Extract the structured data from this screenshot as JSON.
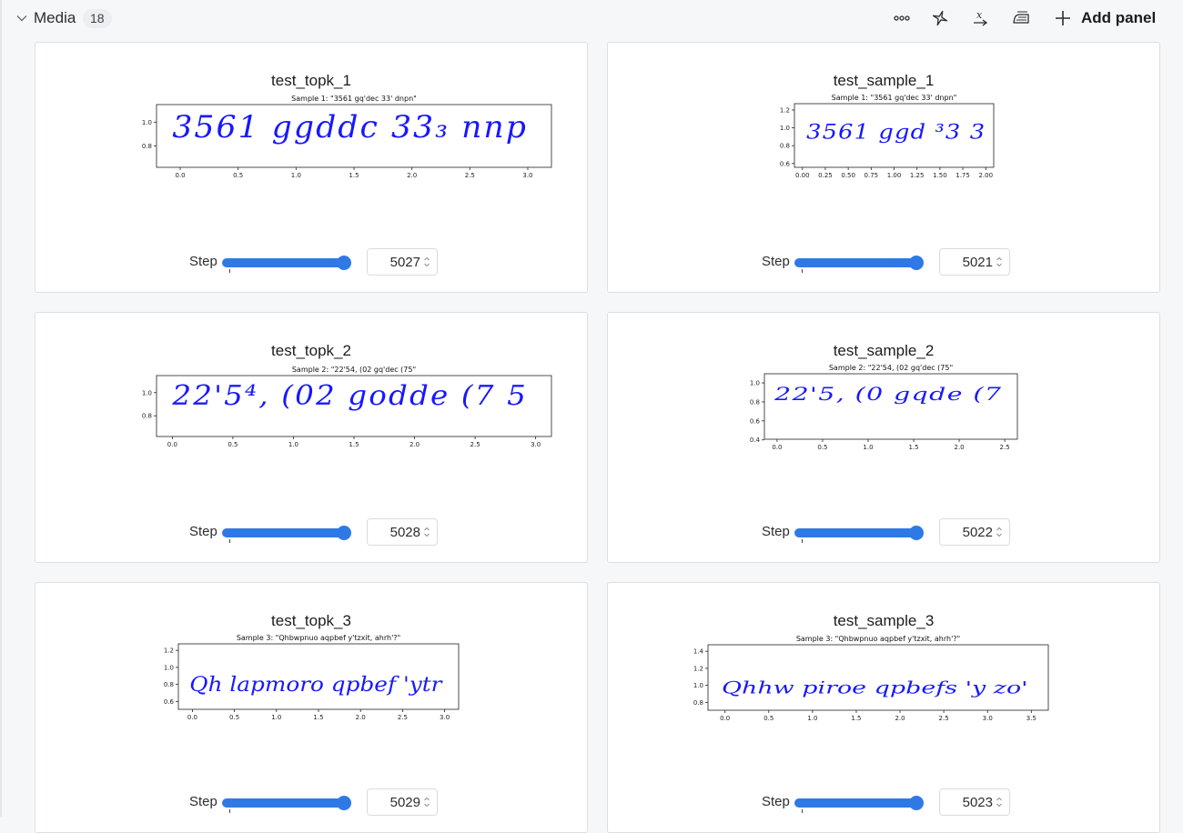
{
  "section": {
    "title": "Media",
    "count": "18",
    "add_panel_label": "Add panel"
  },
  "toolbar": {
    "icons": [
      "more-icon",
      "sparkle-icon",
      "variable-icon",
      "iron-icon",
      "plus-icon"
    ]
  },
  "colors": {
    "accent": "#2f79e6",
    "ink": "#0000ff"
  },
  "step_label": "Step",
  "panels": [
    {
      "title": "test_topk_1",
      "plot_title": "Sample 1: \"3561 gq'dec 33' dnpn\"",
      "x_ticks": [
        "0.0",
        "0.5",
        "1.0",
        "1.5",
        "2.0",
        "2.5",
        "3.0"
      ],
      "y_ticks": [
        "1.0",
        "0.8"
      ],
      "handwriting": "3561 ggddc 33₃ nnp",
      "step_value": "5027"
    },
    {
      "title": "test_sample_1",
      "plot_title": "Sample 1: \"3561 gq'dec 33' dnpn\"",
      "x_ticks": [
        "0.00",
        "0.25",
        "0.50",
        "0.75",
        "1.00",
        "1.25",
        "1.50",
        "1.75",
        "2.00"
      ],
      "y_ticks": [
        "1.2",
        "1.0",
        "0.8",
        "0.6"
      ],
      "handwriting": "3561 ggd  ³3 3",
      "step_value": "5021"
    },
    {
      "title": "test_topk_2",
      "plot_title": "Sample 2: \"22'54, (02 gq'dec (75\"",
      "x_ticks": [
        "0.0",
        "0.5",
        "1.0",
        "1.5",
        "2.0",
        "2.5",
        "3.0"
      ],
      "y_ticks": [
        "1.0",
        "0.8"
      ],
      "handwriting": "22'5⁴, (02 godde (7 5",
      "step_value": "5028"
    },
    {
      "title": "test_sample_2",
      "plot_title": "Sample 2: \"22'54, (02 gq'dec (75\"",
      "x_ticks": [
        "0.0",
        "0.5",
        "1.0",
        "1.5",
        "2.0",
        "2.5"
      ],
      "y_ticks": [
        "1.0",
        "0.8",
        "0.6",
        "0.4"
      ],
      "handwriting": "22'5, (0 gqde (7",
      "step_value": "5022"
    },
    {
      "title": "test_topk_3",
      "plot_title": "Sample 3: \"Qhbwpnuo aqpbef y'tzxit, ahrh'?\"",
      "x_ticks": [
        "0.0",
        "0.5",
        "1.0",
        "1.5",
        "2.0",
        "2.5",
        "3.0"
      ],
      "y_ticks": [
        "1.2",
        "1.0",
        "0.8",
        "0.6"
      ],
      "handwriting": "Qh lapmoro qpbef 'ytr",
      "step_value": "5029"
    },
    {
      "title": "test_sample_3",
      "plot_title": "Sample 3: \"Qhbwpnuo aqpbef y'tzxit, ahrh'?\"",
      "x_ticks": [
        "0.0",
        "0.5",
        "1.0",
        "1.5",
        "2.0",
        "2.5",
        "3.0",
        "3.5"
      ],
      "y_ticks": [
        "1.4",
        "1.2",
        "1.0",
        "0.8"
      ],
      "handwriting": "Qhhw piroe qpbefs 'y zo'",
      "step_value": "5023"
    }
  ]
}
